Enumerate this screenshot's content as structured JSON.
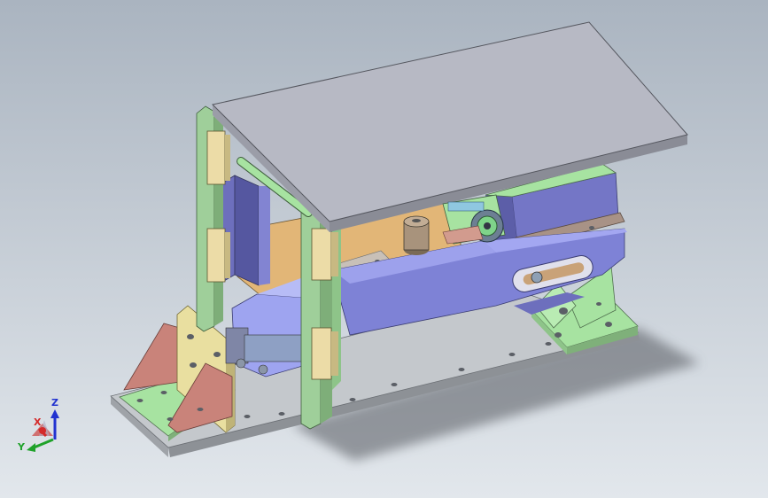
{
  "viewport": {
    "background_top": "#aab4c0",
    "background_bottom": "#e2e7ec"
  },
  "triad": {
    "x_label": "X",
    "y_label": "Y",
    "z_label": "Z",
    "x_color": "#d42a2a",
    "y_color": "#1fa22a",
    "z_color": "#2233d0"
  },
  "colors": {
    "base_plate": "#c4c8cc",
    "top_plate": "#b7b9c4",
    "rail": "#9fcf9a",
    "bracket_gusset": "#c9837a",
    "bracket_plate": "#e9dfa0",
    "cylinder": "#9ea4f0",
    "arm": "#7e82d6",
    "slider_block": "#ecdca7",
    "orange_plate": "#e2b677",
    "green_base": "#a7e3a1",
    "dark_blue_block": "#6d6fbd"
  }
}
